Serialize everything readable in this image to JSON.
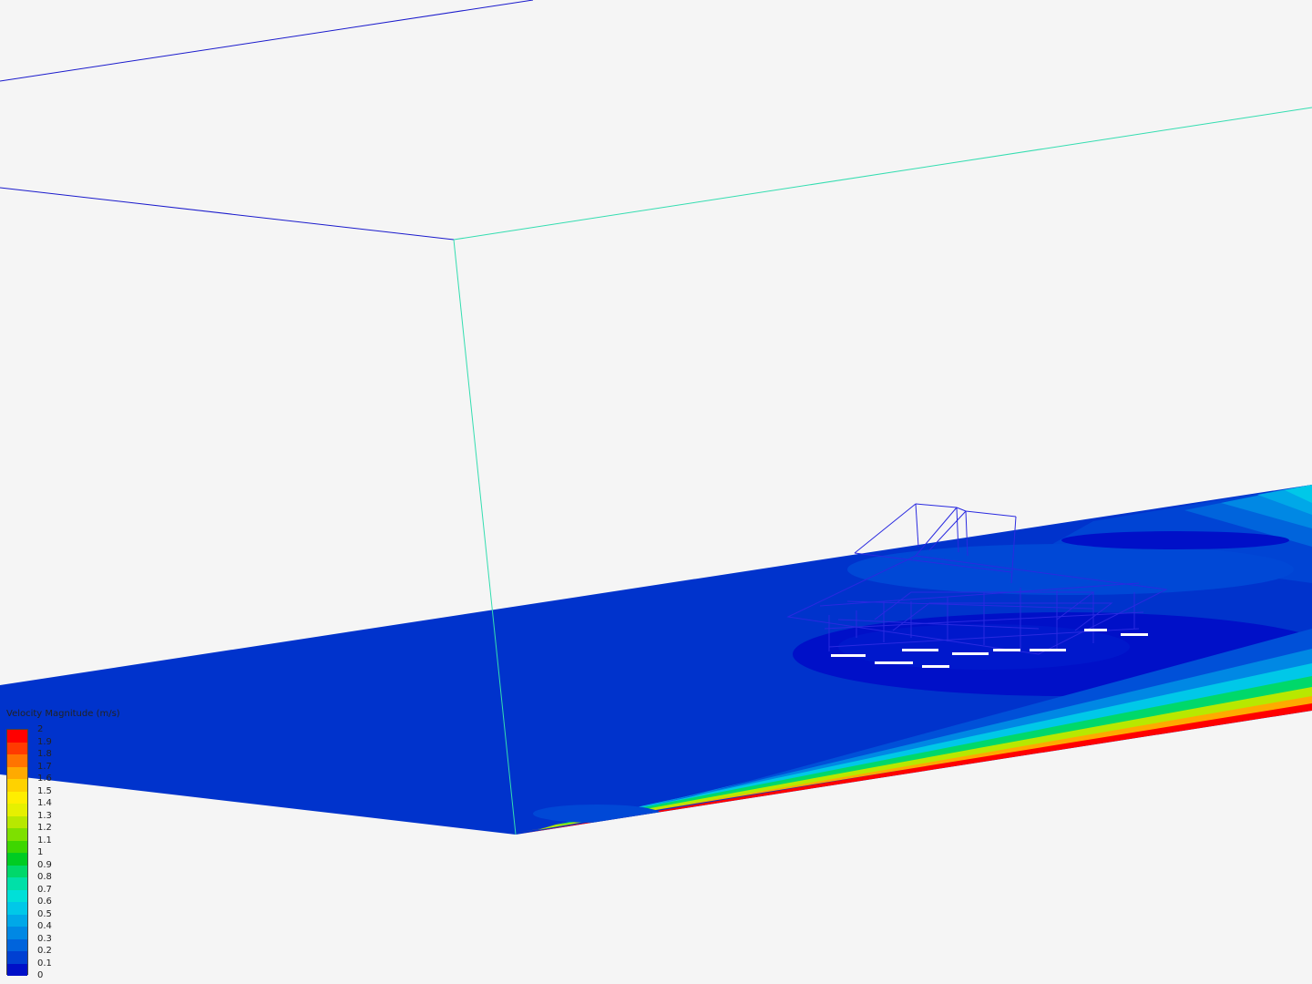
{
  "viewer": {
    "background": "#f5f5f5",
    "plane_base_color": "#0033cc",
    "wire_color": "#1a1acc",
    "edge_color": "#33ddb0"
  },
  "legend": {
    "title": "Velocity Magnitude (m/s)",
    "ticks": [
      "2",
      "1.9",
      "1.8",
      "1.7",
      "1.6",
      "1.5",
      "1.4",
      "1.3",
      "1.2",
      "1.1",
      "1",
      "0.9",
      "0.8",
      "0.7",
      "0.6",
      "0.5",
      "0.4",
      "0.3",
      "0.2",
      "0.1",
      "0"
    ],
    "colors": [
      "#ff0000",
      "#ff3a00",
      "#ff7400",
      "#ffaa00",
      "#ffd200",
      "#ffee00",
      "#e6f000",
      "#b8e800",
      "#7ee000",
      "#3ed600",
      "#00cc22",
      "#00d86a",
      "#00e0a8",
      "#00e0d8",
      "#00c8e8",
      "#00a8e8",
      "#0088e4",
      "#0064dc",
      "#0040d2",
      "#0010c8"
    ]
  }
}
